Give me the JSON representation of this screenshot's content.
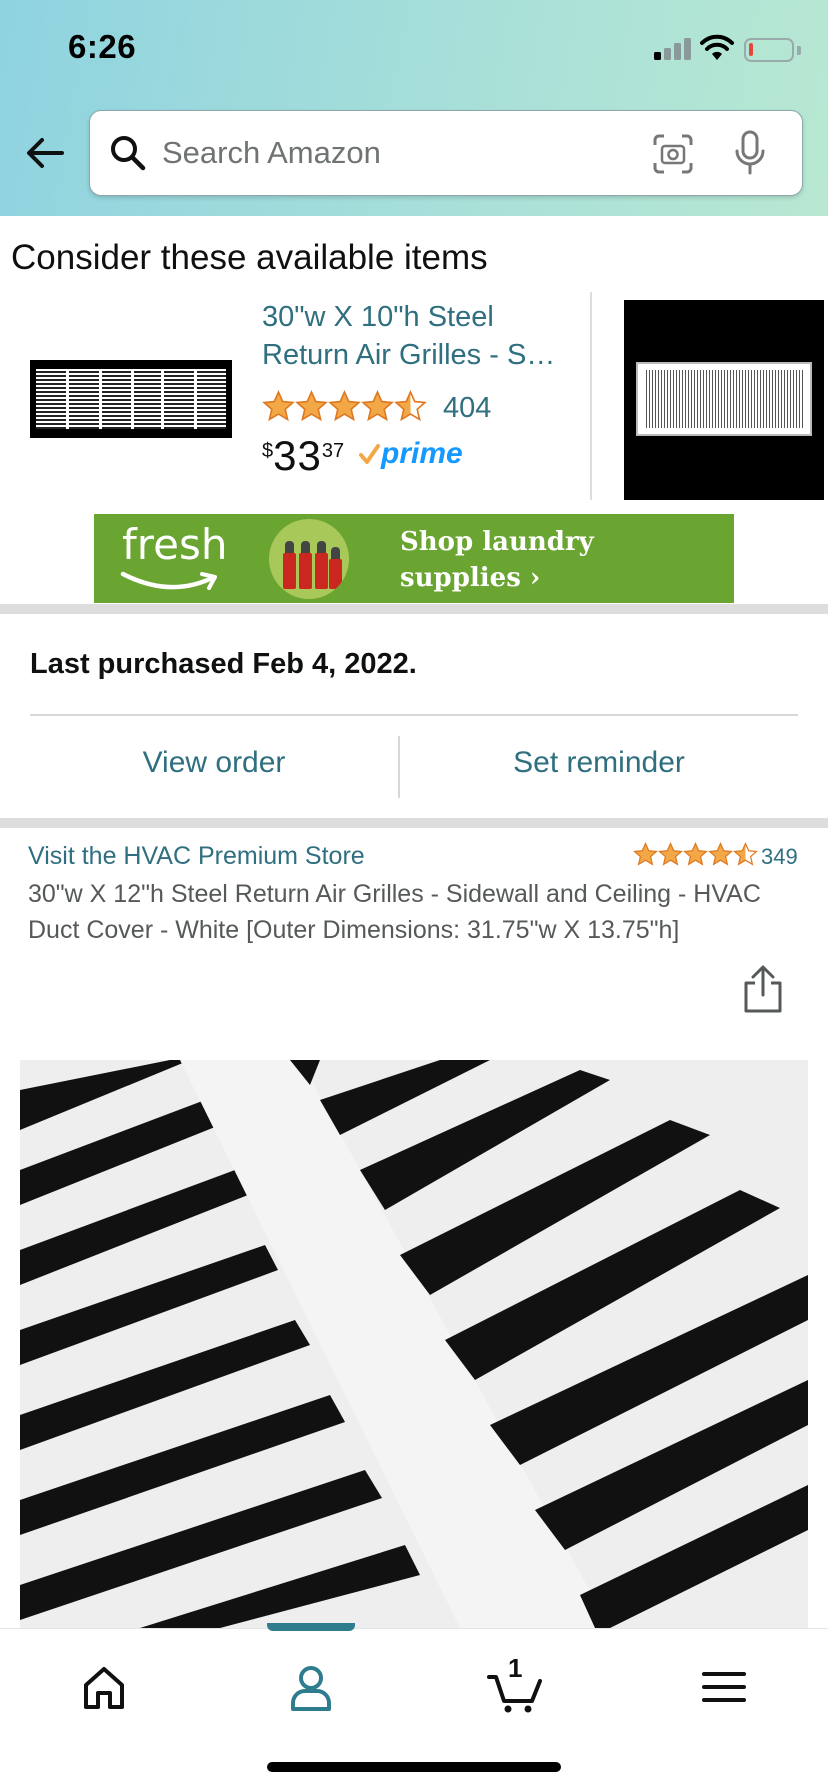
{
  "status_bar": {
    "time": "6:26",
    "battery_level": 0.1
  },
  "search": {
    "placeholder": "Search Amazon",
    "value": ""
  },
  "icons": {
    "back": "arrow-left-icon",
    "search": "magnifier-icon",
    "camera": "camera-scan-icon",
    "mic": "microphone-icon",
    "share": "share-icon",
    "home": "home-icon",
    "account": "person-icon",
    "cart": "cart-icon",
    "menu": "hamburger-menu-icon"
  },
  "consider_section": {
    "title": "Consider these available items",
    "items": [
      {
        "title": "30\"w X 10\"h Steel Return Air Grilles - S…",
        "rating": 4.5,
        "rating_count": "404",
        "price_symbol": "$",
        "price_whole": "33",
        "price_fraction": "37",
        "prime_label": "prime"
      }
    ]
  },
  "fresh_banner": {
    "logo": "fresh",
    "line1": "Shop laundry",
    "line2": "supplies ›"
  },
  "purchase_info": {
    "last_purchased": "Last purchased Feb 4, 2022.",
    "view_order": "View order",
    "set_reminder": "Set reminder"
  },
  "product": {
    "store_link": "Visit the HVAC Premium Store",
    "rating": 4.5,
    "rating_count": "349",
    "title": "30\"w X 12\"h Steel Return Air Grilles - Sidewall and Ceiling - HVAC Duct Cover - White [Outer Dimensions: 31.75\"w X 13.75\"h]"
  },
  "bottom_nav": {
    "active": "account",
    "cart_count": "1"
  },
  "colors": {
    "link": "#2f6f7f",
    "star": "#f3a847",
    "prime": "#1399ff",
    "fresh_green": "#6aa532",
    "nav_active": "#2f7c8e"
  }
}
